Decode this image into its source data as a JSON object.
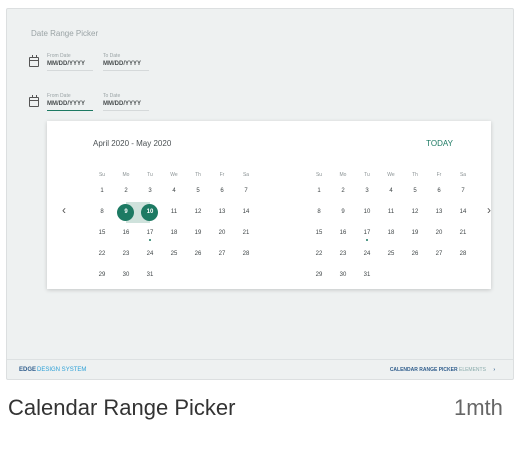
{
  "card": {
    "section_label": "Date Range Picker",
    "row1": {
      "from_label": "From Date",
      "from_value": "MM/DD/YYYY",
      "to_label": "To Date",
      "to_value": "MM/DD/YYYY"
    },
    "row2": {
      "from_label": "From Date",
      "from_value": "MM/DD/YYYY",
      "to_label": "To Date",
      "to_value": "MM/DD/YYYY"
    },
    "popup": {
      "month_range_title": "April 2020 - May 2020",
      "today_label": "TODAY",
      "prev_icon": "chevron-left-icon",
      "next_icon": "chevron-right-icon",
      "weekdays": [
        "Su",
        "Mo",
        "Tu",
        "We",
        "Th",
        "Fr",
        "Sa"
      ],
      "months": [
        {
          "name": "April 2020",
          "rows": [
            [
              "1",
              "2",
              "3",
              "4",
              "5",
              "6",
              "7"
            ],
            [
              "8",
              "9",
              "10",
              "11",
              "12",
              "13",
              "14"
            ],
            [
              "15",
              "16",
              "17",
              "18",
              "19",
              "20",
              "21"
            ],
            [
              "22",
              "23",
              "24",
              "25",
              "26",
              "27",
              "28"
            ],
            [
              "29",
              "30",
              "31",
              "",
              "",
              "",
              ""
            ]
          ],
          "selected_start": "9",
          "selected_end": "10",
          "marked": "17"
        },
        {
          "name": "May 2020",
          "rows": [
            [
              "1",
              "2",
              "3",
              "4",
              "5",
              "6",
              "7"
            ],
            [
              "8",
              "9",
              "10",
              "11",
              "12",
              "13",
              "14"
            ],
            [
              "15",
              "16",
              "17",
              "18",
              "19",
              "20",
              "21"
            ],
            [
              "22",
              "23",
              "24",
              "25",
              "26",
              "27",
              "28"
            ],
            [
              "29",
              "30",
              "31",
              "",
              "",
              "",
              ""
            ]
          ],
          "marked": "17"
        }
      ]
    },
    "footer": {
      "brand_primary": "EDGE",
      "brand_secondary": "DESIGN SYSTEM",
      "crumb_primary": "CALENDAR RANGE PICKER",
      "crumb_secondary": "ELEMENTS",
      "crumb_icon": "chevron-right-icon"
    }
  },
  "caption": {
    "title": "Calendar Range Picker",
    "updated": "1mth"
  },
  "colors": {
    "accent": "#1d7a63",
    "range": "#cfe2dc",
    "card_bg": "#eef1f1"
  }
}
